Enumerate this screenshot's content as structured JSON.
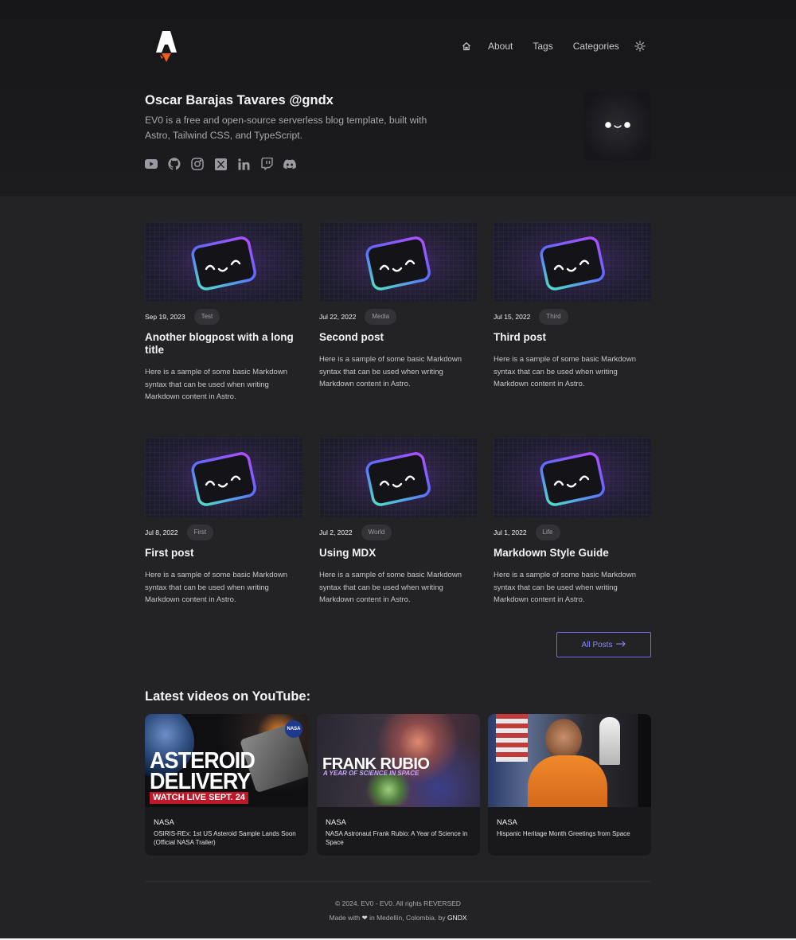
{
  "header": {
    "logo_icon": "rocket-logo-icon",
    "nav": {
      "home_icon": "home-icon",
      "items": [
        {
          "label": "About"
        },
        {
          "label": "Tags"
        },
        {
          "label": "Categories"
        }
      ],
      "theme_icon": "sun-icon"
    }
  },
  "author": {
    "name": "Oscar Barajas Tavares @gndx",
    "description": "EV0 is a free and open-source serverless blog template, built with Astro, Tailwind CSS, and TypeScript.",
    "socials": [
      "youtube-icon",
      "github-icon",
      "instagram-icon",
      "x-icon",
      "linkedin-icon",
      "twitch-icon",
      "discord-icon"
    ]
  },
  "posts": [
    {
      "date": "Sep 19, 2023",
      "tag": "Test",
      "title": "Another blogpost with a long title",
      "excerpt": "Here is a sample of some basic Markdown syntax that can be used when writing Markdown content in Astro."
    },
    {
      "date": "Jul 22, 2022",
      "tag": "Media",
      "title": "Second post",
      "excerpt": "Here is a sample of some basic Markdown syntax that can be used when writing Markdown content in Astro."
    },
    {
      "date": "Jul 15, 2022",
      "tag": "Third",
      "title": "Third post",
      "excerpt": "Here is a sample of some basic Markdown syntax that can be used when writing Markdown content in Astro."
    },
    {
      "date": "Jul 8, 2022",
      "tag": "First",
      "title": "First post",
      "excerpt": "Here is a sample of some basic Markdown syntax that can be used when writing Markdown content in Astro."
    },
    {
      "date": "Jul 2, 2022",
      "tag": "World",
      "title": "Using MDX",
      "excerpt": "Here is a sample of some basic Markdown syntax that can be used when writing Markdown content in Astro."
    },
    {
      "date": "Jul 1, 2022",
      "tag": "Life",
      "title": "Markdown Style Guide",
      "excerpt": "Here is a sample of some basic Markdown syntax that can be used when writing Markdown content in Astro."
    }
  ],
  "all_posts_label": "All Posts",
  "youtube": {
    "heading": "Latest videos on YouTube:",
    "videos": [
      {
        "channel": "NASA",
        "title": "OSIRIS-REx: 1st US Asteroid Sample Lands Soon (Official NASA Trailer)",
        "thumb_line1": "ASTEROID",
        "thumb_line2": "DELIVERY",
        "thumb_line3": "WATCH LIVE SEPT. 24",
        "thumb_badge": "NASA"
      },
      {
        "channel": "NASA",
        "title": "NASA Astronaut Frank Rubio: A Year of Science in Space",
        "thumb_line1": "FRANK RUBIO",
        "thumb_line2": "A YEAR OF SCIENCE IN SPACE"
      },
      {
        "channel": "NASA",
        "title": "Hispanic Heritage Month Greetings from Space"
      }
    ]
  },
  "footer": {
    "copyright": "© 2024. EV0 - EV0. All rights REVERSED",
    "made_prefix": "Made with",
    "made_suffix": "in Medellín, Colombia. by",
    "author_link": "GNDX"
  },
  "colors": {
    "background": "#232326",
    "hero_background": "#19191b",
    "accent": "#6d6ee8",
    "logo_flame": "#f05a1a"
  }
}
